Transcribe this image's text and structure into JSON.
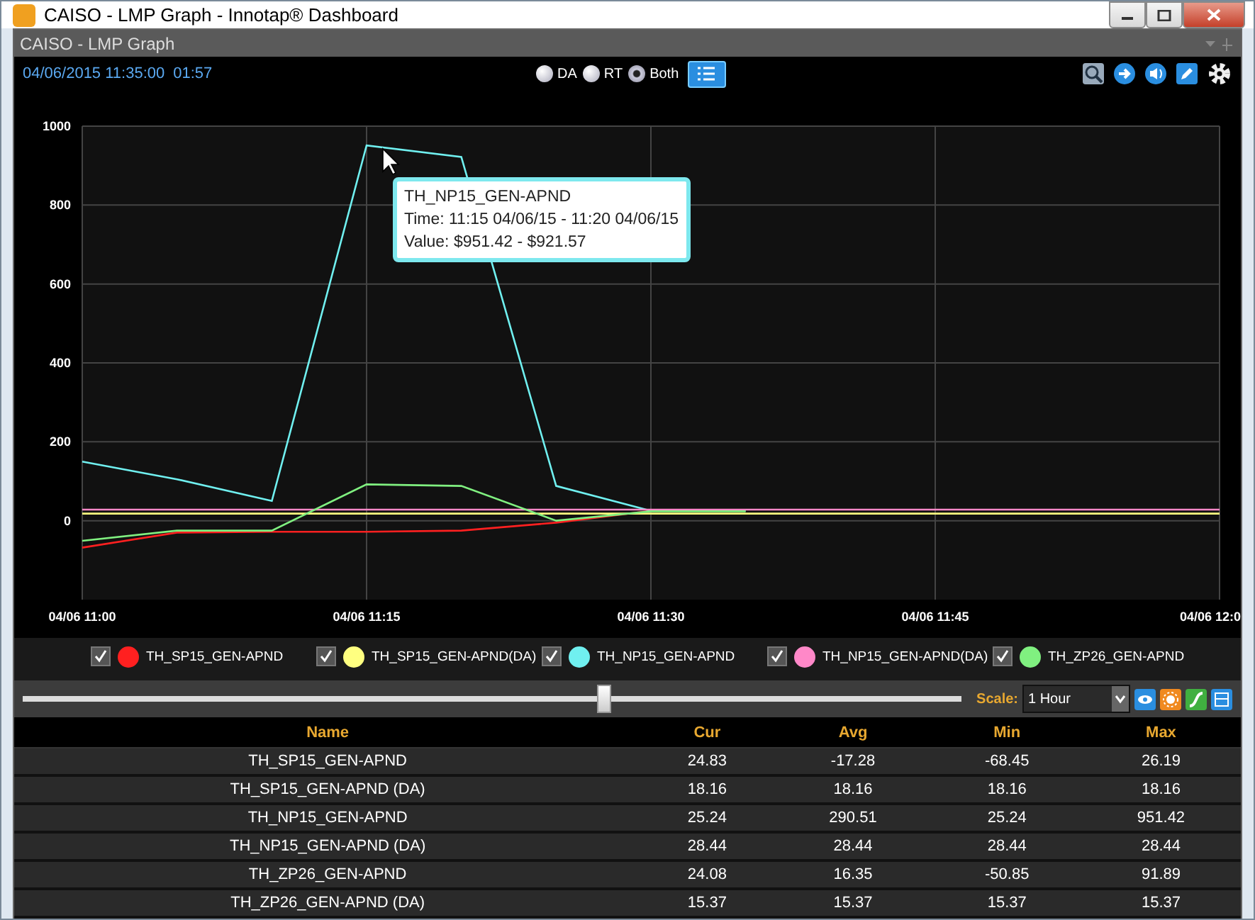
{
  "window": {
    "title": "CAISO - LMP Graph - Innotap® Dashboard"
  },
  "panel": {
    "title": "CAISO - LMP Graph"
  },
  "toolbar": {
    "timestamp": "04/06/2015 11:35:00",
    "countdown": "01:57",
    "modes": [
      {
        "label": "DA",
        "selected": false
      },
      {
        "label": "RT",
        "selected": false
      },
      {
        "label": "Both",
        "selected": true
      }
    ]
  },
  "chart": {
    "chart_data": {
      "type": "line",
      "categories": [
        "04/06 11:00",
        null,
        null,
        "04/06 11:15",
        null,
        null,
        "04/06 11:30",
        null,
        null,
        "04/06 11:45",
        null,
        null,
        "04/06 12:0"
      ],
      "ylim": [
        -200,
        1000
      ],
      "grid": true,
      "yticks": [
        0,
        200,
        400,
        600,
        800,
        1000
      ],
      "series": [
        {
          "name": "TH_SP15_GEN-APND",
          "color": "#ff2020",
          "values": [
            -68,
            -30,
            -28,
            -28,
            -25,
            -5,
            25,
            null,
            null,
            null,
            null,
            null,
            null
          ]
        },
        {
          "name": "TH_SP15_GEN-APND(DA)",
          "color": "#ffff80",
          "values": [
            18,
            18,
            18,
            18,
            18,
            18,
            18,
            18,
            18,
            18,
            18,
            18,
            18
          ]
        },
        {
          "name": "TH_NP15_GEN-APND",
          "color": "#70f0f0",
          "values": [
            150,
            105,
            50,
            951,
            922,
            88,
            25,
            25,
            null,
            null,
            null,
            null,
            null
          ]
        },
        {
          "name": "TH_NP15_GEN-APND(DA)",
          "color": "#ff88c8",
          "values": [
            28,
            28,
            28,
            28,
            28,
            28,
            28,
            28,
            28,
            28,
            28,
            28,
            28
          ]
        },
        {
          "name": "TH_ZP26_GEN-APND",
          "color": "#80f080",
          "values": [
            -51,
            -25,
            -25,
            92,
            88,
            0,
            24,
            24,
            null,
            null,
            null,
            null,
            null
          ]
        }
      ]
    },
    "tooltip": {
      "title": "TH_NP15_GEN-APND",
      "time": "Time: 11:15 04/06/15 - 11:20 04/06/15",
      "value": "Value: $951.42 - $921.57"
    }
  },
  "legend": [
    {
      "checked": true
    },
    {
      "checked": true
    },
    {
      "checked": true
    },
    {
      "checked": true
    },
    {
      "checked": true
    }
  ],
  "timeline": {
    "level": 0.62,
    "scale_label": "Scale:",
    "scale_value": "1 Hour"
  },
  "table": {
    "columns": [
      "Name",
      "Cur",
      "Avg",
      "Min",
      "Max"
    ],
    "rows": [
      [
        "TH_SP15_GEN-APND",
        "24.83",
        "-17.28",
        "-68.45",
        "26.19"
      ],
      [
        "TH_SP15_GEN-APND (DA)",
        "18.16",
        "18.16",
        "18.16",
        "18.16"
      ],
      [
        "TH_NP15_GEN-APND",
        "25.24",
        "290.51",
        "25.24",
        "951.42"
      ],
      [
        "TH_NP15_GEN-APND (DA)",
        "28.44",
        "28.44",
        "28.44",
        "28.44"
      ],
      [
        "TH_ZP26_GEN-APND",
        "24.08",
        "16.35",
        "-50.85",
        "91.89"
      ],
      [
        "TH_ZP26_GEN-APND (DA)",
        "15.37",
        "15.37",
        "15.37",
        "15.37"
      ]
    ]
  }
}
